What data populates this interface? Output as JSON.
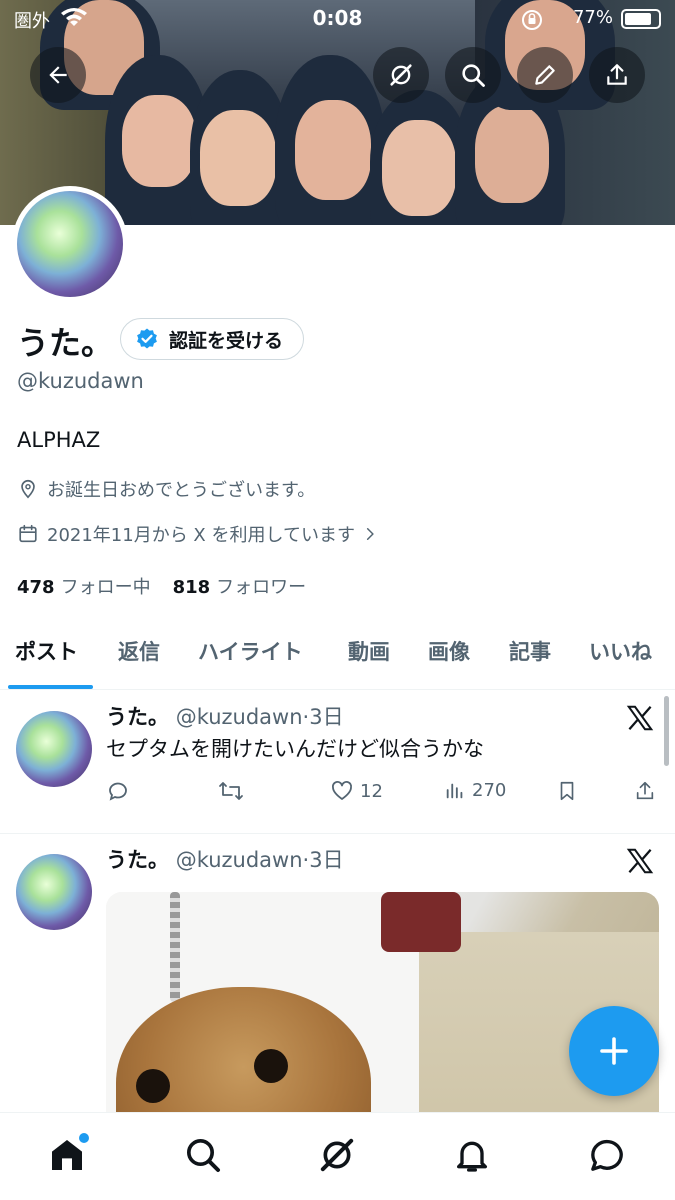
{
  "status_bar": {
    "carrier": "圏外",
    "time": "0:08",
    "battery": "77%"
  },
  "profile": {
    "display_name": "うた。",
    "verify_button": "認証を受ける",
    "handle": "@kuzudawn",
    "bio": "ALPHAZ",
    "location": "お誕生日おめでとうございます。",
    "joined": "2021年11月から X を利用しています",
    "following_count": "478",
    "following_label": "フォロー中",
    "followers_count": "818",
    "followers_label": "フォロワー"
  },
  "tabs": [
    "ポスト",
    "返信",
    "ハイライト",
    "動画",
    "画像",
    "記事",
    "いいね"
  ],
  "posts": [
    {
      "name": "うた。",
      "handle": "@kuzudawn",
      "time": "3日",
      "text": "セプタムを開けたいんだけど似合うかな",
      "likes": "12",
      "views": "270"
    },
    {
      "name": "うた。",
      "handle": "@kuzudawn",
      "time": "3日"
    }
  ],
  "icons": {
    "verified": "verified-badge-icon",
    "location": "location-pin-icon",
    "calendar": "calendar-icon"
  },
  "colors": {
    "accent": "#1d9bf0",
    "text": "#0f1419",
    "muted": "#536471"
  }
}
